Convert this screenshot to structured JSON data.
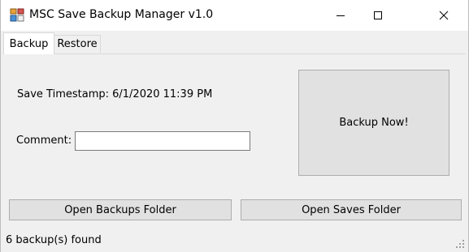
{
  "window": {
    "title": "MSC Save Backup Manager v1.0",
    "icon": "app-grid-icon"
  },
  "titlebar_buttons": {
    "minimize": "minimize-icon",
    "maximize": "maximize-icon",
    "close": "close-icon"
  },
  "tabs": [
    {
      "label": "Backup",
      "active": true
    },
    {
      "label": "Restore",
      "active": false
    }
  ],
  "backup_tab": {
    "save_timestamp": "Save Timestamp: 6/1/2020 11:39 PM",
    "comment_label": "Comment:",
    "comment_value": "",
    "backup_now_label": "Backup Now!"
  },
  "buttons": {
    "open_backups_folder": "Open Backups Folder",
    "open_saves_folder": "Open Saves Folder"
  },
  "status": {
    "text": "6 backup(s) found"
  },
  "colors": {
    "window_bg": "#f0f0f0",
    "button_bg": "#e1e1e1",
    "button_border": "#adadad",
    "titlebar_bg": "#ffffff"
  }
}
